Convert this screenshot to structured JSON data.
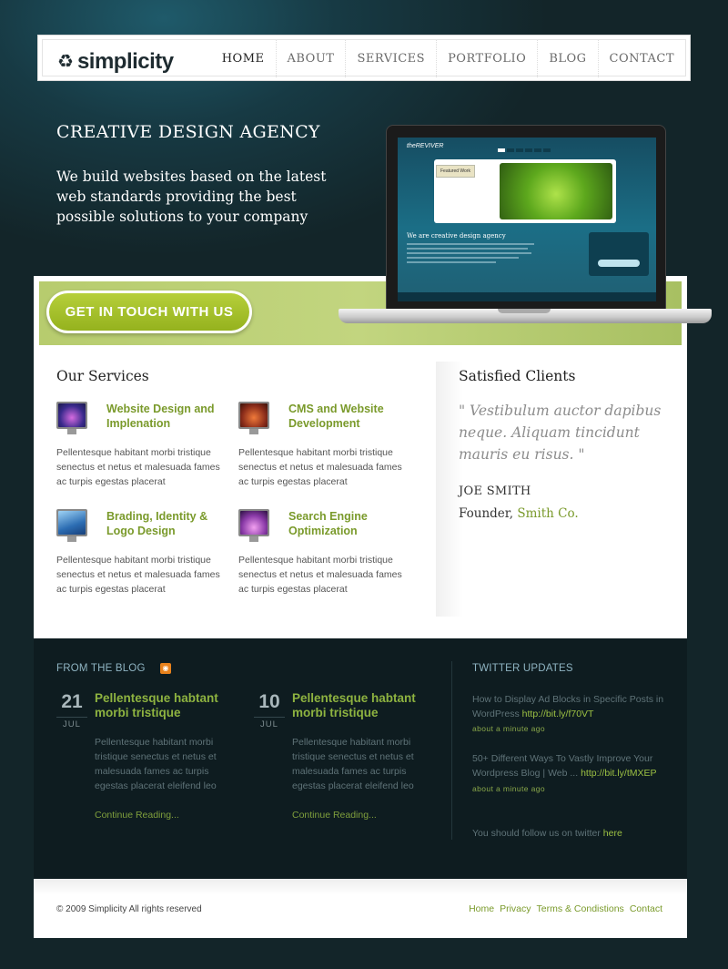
{
  "header": {
    "logo": "simplicity",
    "nav": [
      "HOME",
      "ABOUT",
      "SERVICES",
      "PORTFOLIO",
      "BLOG",
      "CONTACT"
    ]
  },
  "hero": {
    "title": "CREATIVE DESIGN AGENCY",
    "text": "We build websites based on the latest web standards providing the best possible solutions to your company",
    "cta": "GET IN TOUCH WITH US"
  },
  "laptop_preview": {
    "logo": "theREVIVER",
    "featured": "Featured Work",
    "heading": "We are creative design agency",
    "quote_button": "Free Quote"
  },
  "services": {
    "title": "Our Services",
    "items": [
      {
        "title": "Website Design and Implenation",
        "text": "Pellentesque habitant morbi tristique senectus et netus et malesuada fames ac turpis egestas placerat"
      },
      {
        "title": "CMS and Website Development",
        "text": "Pellentesque habitant morbi tristique senectus et netus et malesuada fames ac turpis egestas placerat"
      },
      {
        "title": "Brading, Identity & Logo Design",
        "text": "Pellentesque habitant morbi tristique senectus et netus et malesuada fames ac turpis egestas placerat"
      },
      {
        "title": "Search Engine Optimization",
        "text": "Pellentesque habitant morbi tristique senectus et netus et malesuada fames ac turpis egestas placerat"
      }
    ]
  },
  "clients": {
    "title": "Satisfied Clients",
    "quote": "\" Vestibulum auctor dapibus neque. Aliquam tincidunt mauris eu risus. \"",
    "name": "JOE SMITH",
    "role": "Founder,",
    "company": "Smith Co."
  },
  "blog": {
    "title": "FROM THE BLOG",
    "posts": [
      {
        "day": "21",
        "month": "JUL",
        "title": "Pellentesque habtant morbi tristique",
        "text": "Pellentesque habitant morbi tristique senectus et netus et malesuada fames ac turpis egestas placerat eleifend leo",
        "link": "Continue Reading..."
      },
      {
        "day": "10",
        "month": "JUL",
        "title": "Pellentesque habtant morbi tristique",
        "text": "Pellentesque habitant morbi tristique senectus et netus et malesuada fames ac turpis egestas placerat eleifend leo",
        "link": "Continue Reading..."
      }
    ]
  },
  "twitter": {
    "title": "TWITTER UPDATES",
    "tweets": [
      {
        "text": "How to Display Ad Blocks in Specific Posts in WordPress",
        "link": "http://bit.ly/f70VT",
        "time": "about a minute ago"
      },
      {
        "text": "50+ Different Ways To Vastly Improve Your Wordpress Blog | Web ...",
        "link": "http://bit.ly/tMXEP",
        "time": "about a minute ago"
      }
    ],
    "follow_text": "You should follow us on twitter",
    "follow_link": "here"
  },
  "footer": {
    "copyright": "© 2009 Simplicity All rights reserved",
    "links": [
      "Home",
      "Privacy",
      "Terms & Condistions",
      "Contact"
    ]
  }
}
